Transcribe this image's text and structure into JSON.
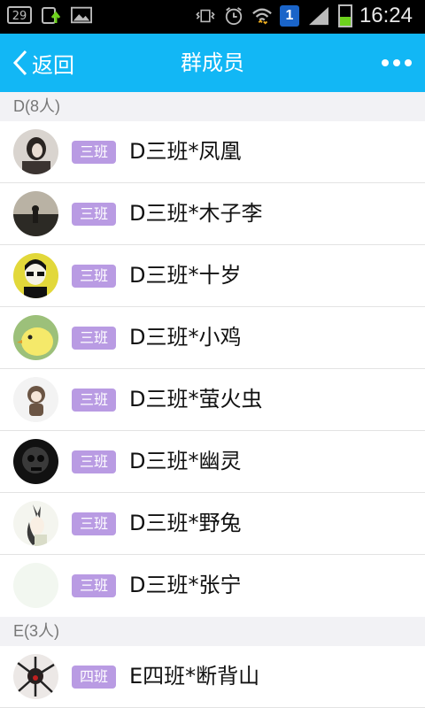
{
  "status_bar": {
    "calendar_day": "29",
    "notification_count": "1",
    "time": "16:24",
    "icons": [
      "calendar-icon",
      "upload-icon",
      "image-icon",
      "vibrate-icon",
      "alarm-icon",
      "wifi-icon",
      "signal-icon",
      "battery-icon"
    ]
  },
  "header": {
    "back_label": "返回",
    "title": "群成员",
    "background": "#12b7f5"
  },
  "sections": [
    {
      "label": "D(8人)",
      "members": [
        {
          "tag": "三班",
          "name": "D三班*凤凰",
          "tag_color": "#b99be3"
        },
        {
          "tag": "三班",
          "name": "D三班*木子李",
          "tag_color": "#b99be3"
        },
        {
          "tag": "三班",
          "name": "D三班*十岁",
          "tag_color": "#b99be3"
        },
        {
          "tag": "三班",
          "name": "D三班*小鸡",
          "tag_color": "#b99be3"
        },
        {
          "tag": "三班",
          "name": "D三班*萤火虫",
          "tag_color": "#b99be3"
        },
        {
          "tag": "三班",
          "name": "D三班*幽灵",
          "tag_color": "#b99be3"
        },
        {
          "tag": "三班",
          "name": "D三班*野兔",
          "tag_color": "#b99be3"
        },
        {
          "tag": "三班",
          "name": "D三班*张宁",
          "tag_color": "#b99be3"
        }
      ]
    },
    {
      "label": "E(3人)",
      "members": [
        {
          "tag": "四班",
          "name": "E四班*断背山",
          "tag_color": "#b99be3"
        }
      ]
    }
  ]
}
